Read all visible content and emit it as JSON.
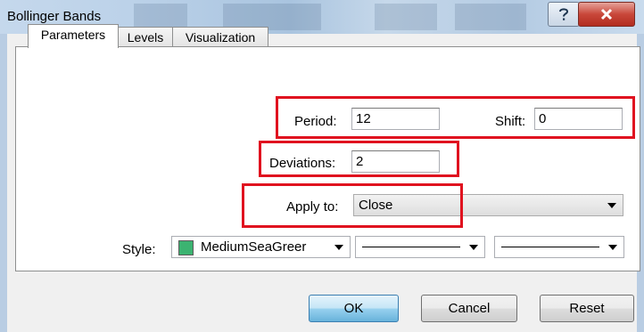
{
  "window": {
    "title": "Bollinger Bands",
    "help_glyph": "?",
    "close_glyph": "X"
  },
  "tabs": [
    {
      "label": "Parameters",
      "active": true
    },
    {
      "label": "Levels",
      "active": false
    },
    {
      "label": "Visualization",
      "active": false
    }
  ],
  "params": {
    "period_label": "Period:",
    "period_value": "12",
    "shift_label": "Shift:",
    "shift_value": "0",
    "deviations_label": "Deviations:",
    "deviations_value": "2",
    "apply_label": "Apply to:",
    "apply_value": "Close",
    "style_label": "Style:",
    "style_color_name": "MediumSeaGreer",
    "style_color": "#3cb371"
  },
  "buttons": {
    "ok": "OK",
    "cancel": "Cancel",
    "reset": "Reset"
  },
  "highlight_color": "#e0121f"
}
